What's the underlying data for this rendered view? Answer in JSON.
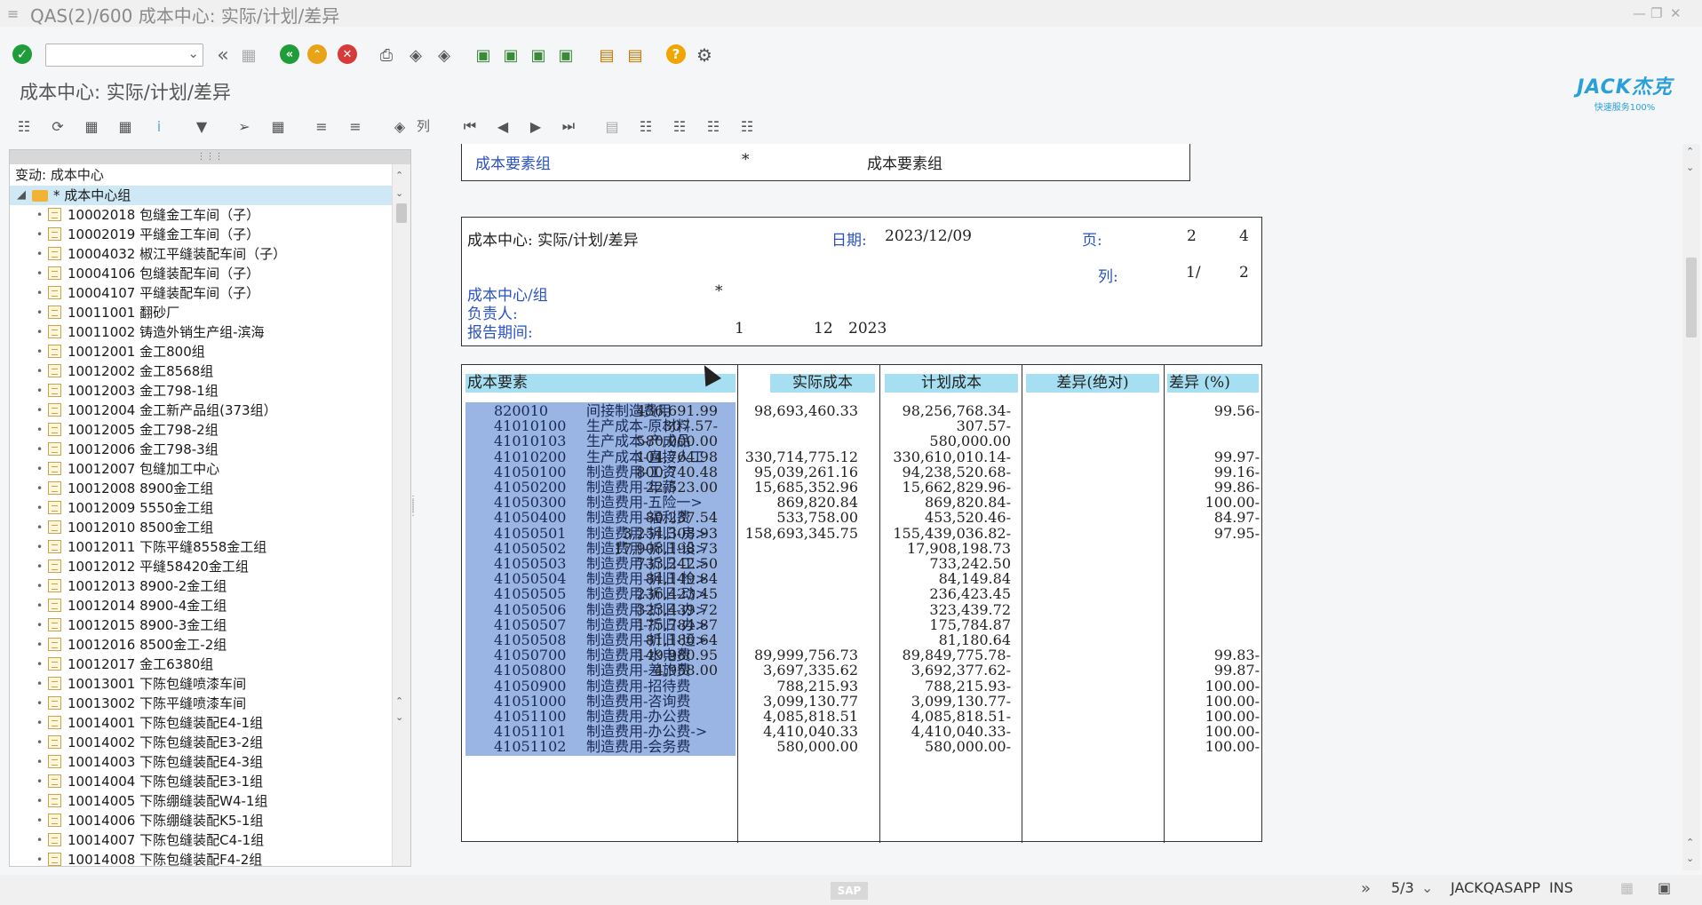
{
  "window": {
    "title": "QAS(2)/600 成本中心: 实际/计划/差异"
  },
  "header": {
    "title": "成本中心: 实际/计划/差异",
    "logo_main": "JACK杰克",
    "logo_sub": "快速服务100%"
  },
  "toolbar2": {
    "col_label": "列"
  },
  "tree": {
    "header": "变动:  成本中心",
    "root": "* 成本中心组",
    "items": [
      "10002018 包缝金工车间（子）",
      "10002019 平缝金工车间（子）",
      "10004032 椒江平缝装配车间（子）",
      "10004106 包缝装配车间（子）",
      "10004107 平缝装配车间（子）",
      "10011001 翻砂厂",
      "10011002 铸造外销生产组-滨海",
      "10012001 金工800组",
      "10012002 金工8568组",
      "10012003 金工798-1组",
      "10012004 金工新产品组(373组）",
      "10012005 金工798-2组",
      "10012006 金工798-3组",
      "10012007 包缝加工中心",
      "10012008 8900金工组",
      "10012009 5550金工组",
      "10012010 8500金工组",
      "10012011 下陈平缝8558金工组",
      "10012012 平缝58420金工组",
      "10012013 8900-2金工组",
      "10012014 8900-4金工组",
      "10012015 8900-3金工组",
      "10012016 8500金工-2组",
      "10012017 金工6380组",
      "10013001 下陈包缝喷漆车间",
      "10013002 下陈平缝喷漆车间",
      "10014001 下陈包缝装配E4-1组",
      "10014002 下陈包缝装配E3-2组",
      "10014003 下陈包缝装配E4-3组",
      "10014004 下陈包缝装配E3-1组",
      "10014005 下陈绷缝装配W4-1组",
      "10014006 下陈绷缝装配K5-1组",
      "10014007 下陈包缝装配C4-1组",
      "10014008 下陈包缝装配F4-2组"
    ]
  },
  "report": {
    "top_box": {
      "label": "成本要素组",
      "star": "*",
      "value": "成本要素组"
    },
    "info": {
      "title": "成本中心: 实际/计划/差异",
      "date_label": "日期:",
      "date": "2023/12/09",
      "page_label": "页:",
      "page": "2",
      "page_total": "4",
      "col_label": "列:",
      "col": "1/",
      "col_total": "2",
      "cc_label": "成本中心/组",
      "cc_value": "*",
      "owner_label": "负责人:",
      "period_label": "报告期间:",
      "period_from": "1",
      "period_to": "12",
      "year": "2023"
    },
    "columns": [
      "成本要素",
      "实际成本",
      "计划成本",
      "差异(绝对)",
      "差异 (%)"
    ],
    "rows": [
      {
        "code": "820010",
        "name": "间接制造费用",
        "actual": "436,691.99",
        "plan": "98,693,460.33",
        "diff": "98,256,768.34-",
        "pct": "99.56-"
      },
      {
        "code": "41010100",
        "name": "生产成本-原材料",
        "actual": "307.57-",
        "plan": "",
        "diff": "307.57-",
        "pct": ""
      },
      {
        "code": "41010103",
        "name": "生产成本-产成品",
        "actual": "580,000.00",
        "plan": "",
        "diff": "580,000.00",
        "pct": ""
      },
      {
        "code": "41010200",
        "name": "生产成本-直接人工",
        "actual": "104,764.98",
        "plan": "330,714,775.12",
        "diff": "330,610,010.14-",
        "pct": "99.97-"
      },
      {
        "code": "41050100",
        "name": "制造费用-工资",
        "actual": "800,740.48",
        "plan": "95,039,261.16",
        "diff": "94,238,520.68-",
        "pct": "99.16-"
      },
      {
        "code": "41050200",
        "name": "制造费用-年薪",
        "actual": "22,523.00",
        "plan": "15,685,352.96",
        "diff": "15,662,829.96-",
        "pct": "99.86-"
      },
      {
        "code": "41050300",
        "name": "制造费用-五险一>",
        "actual": "",
        "plan": "869,820.84",
        "diff": "869,820.84-",
        "pct": "100.00-"
      },
      {
        "code": "41050400",
        "name": "制造费用-福利费",
        "actual": "80,237.54",
        "plan": "533,758.00",
        "diff": "453,520.46-",
        "pct": "84.97-"
      },
      {
        "code": "41050501",
        "name": "制造费用-折旧-房>",
        "actual": "3,254,308.93",
        "plan": "158,693,345.75",
        "diff": "155,439,036.82-",
        "pct": "97.95-"
      },
      {
        "code": "41050502",
        "name": "制造费用-折旧-设>",
        "actual": "17,908,198.73",
        "plan": "",
        "diff": "17,908,198.73",
        "pct": ""
      },
      {
        "code": "41050503",
        "name": "制造费用-折旧-工>",
        "actual": "733,242.50",
        "plan": "",
        "diff": "733,242.50",
        "pct": ""
      },
      {
        "code": "41050504",
        "name": "制造费用-折旧-检>",
        "actual": "84,149.84",
        "plan": "",
        "diff": "84,149.84",
        "pct": ""
      },
      {
        "code": "41050505",
        "name": "制造费用-折旧-动>",
        "actual": "236,423.45",
        "plan": "",
        "diff": "236,423.45",
        "pct": ""
      },
      {
        "code": "41050506",
        "name": "制造费用-折旧-办>",
        "actual": "323,439.72",
        "plan": "",
        "diff": "323,439.72",
        "pct": ""
      },
      {
        "code": "41050507",
        "name": "制造费用-折旧-办>",
        "actual": "175,784.87",
        "plan": "",
        "diff": "175,784.87",
        "pct": ""
      },
      {
        "code": "41050508",
        "name": "制造费用-折旧-运>",
        "actual": "81,180.64",
        "plan": "",
        "diff": "81,180.64",
        "pct": ""
      },
      {
        "code": "41050700",
        "name": "制造费用-水电费",
        "actual": "149,980.95",
        "plan": "89,999,756.73",
        "diff": "89,849,775.78-",
        "pct": "99.83-"
      },
      {
        "code": "41050800",
        "name": "制造费用-差旅费",
        "actual": "4,958.00",
        "plan": "3,697,335.62",
        "diff": "3,692,377.62-",
        "pct": "99.87-"
      },
      {
        "code": "41050900",
        "name": "制造费用-招待费",
        "actual": "",
        "plan": "788,215.93",
        "diff": "788,215.93-",
        "pct": "100.00-"
      },
      {
        "code": "41051000",
        "name": "制造费用-咨询费",
        "actual": "",
        "plan": "3,099,130.77",
        "diff": "3,099,130.77-",
        "pct": "100.00-"
      },
      {
        "code": "41051100",
        "name": "制造费用-办公费",
        "actual": "",
        "plan": "4,085,818.51",
        "diff": "4,085,818.51-",
        "pct": "100.00-"
      },
      {
        "code": "41051101",
        "name": "制造费用-办公费->",
        "actual": "",
        "plan": "4,410,040.33",
        "diff": "4,410,040.33-",
        "pct": "100.00-"
      },
      {
        "code": "41051102",
        "name": "制造费用-会务费",
        "actual": "",
        "plan": "580,000.00",
        "diff": "580,000.00-",
        "pct": "100.00-"
      }
    ]
  },
  "status": {
    "nav": "5/3",
    "server": "JACKQASAPP",
    "mode": "INS",
    "sap": "SAP"
  },
  "colors": {
    "accent_green": "#1f9d3a",
    "header_cyan": "#a5dff1",
    "row_blue": "#9ab4e4",
    "label_blue": "#2a52c0"
  }
}
